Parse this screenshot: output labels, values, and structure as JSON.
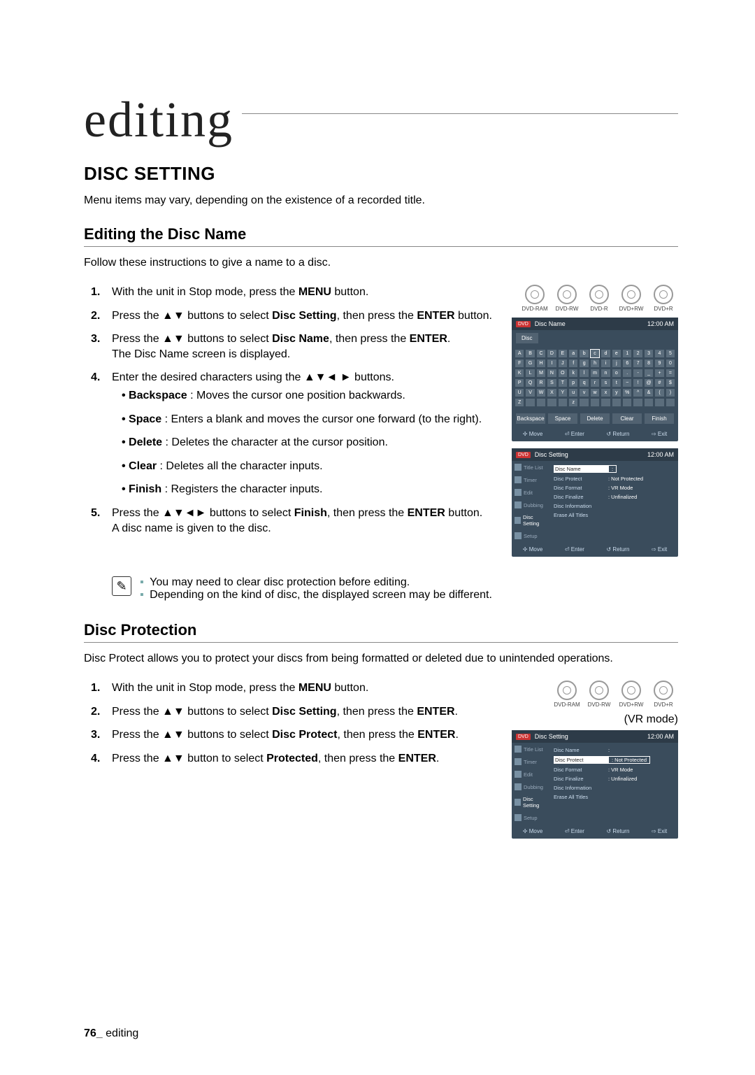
{
  "chapter": "editing",
  "section": "DISC SETTING",
  "intro": "Menu items may vary, depending on the existence of a recorded title.",
  "sub1": {
    "title": "Editing the Disc Name",
    "desc": "Follow these instructions to give a name to a disc.",
    "steps": [
      {
        "n": "1.",
        "pre": "With the unit in Stop mode, press the ",
        "bold": "MENU",
        "post": " button."
      },
      {
        "n": "2.",
        "pre": "Press the ▲▼ buttons to select ",
        "bold": "Disc Setting",
        "post": ", then press the ",
        "bold2": "ENTER",
        "post2": " button."
      },
      {
        "n": "3.",
        "pre": "Press the ▲▼ buttons to select ",
        "bold": "Disc Name",
        "post": ", then press the ",
        "bold2": "ENTER",
        "post2": ".",
        "after": "The Disc Name screen is displayed."
      },
      {
        "n": "4.",
        "pre": "Enter the desired characters using the ▲▼◄ ► buttons.",
        "bullets": [
          {
            "b": "Backspace",
            "t": " : Moves the cursor one position backwards."
          },
          {
            "b": "Space",
            "t": " : Enters a blank and moves the cursor one forward (to the right)."
          },
          {
            "b": "Delete",
            "t": " : Deletes the character at the cursor position."
          },
          {
            "b": "Clear",
            "t": " : Deletes all the character inputs."
          },
          {
            "b": "Finish",
            "t": " : Registers the character inputs."
          }
        ]
      },
      {
        "n": "5.",
        "pre": "Press the ▲▼◄► buttons to select ",
        "bold": "Finish",
        "post": ", then press the ",
        "bold2": "ENTER",
        "post2": " button.",
        "after": "A disc name is given to the disc."
      }
    ],
    "notes": [
      "You may need to clear disc protection before editing.",
      "Depending on the kind of disc, the displayed screen may be different."
    ],
    "disctypes": [
      "DVD-RAM",
      "DVD-RW",
      "DVD-R",
      "DVD+RW",
      "DVD+R"
    ]
  },
  "osd1": {
    "title": "Disc Name",
    "time": "12:00 AM",
    "tab": "Disc",
    "rows": [
      [
        "A",
        "B",
        "C",
        "D",
        "E",
        "a",
        "b",
        "c",
        "d",
        "e",
        "1",
        "2",
        "3",
        "4",
        "5"
      ],
      [
        "F",
        "G",
        "H",
        "I",
        "J",
        "f",
        "g",
        "h",
        "i",
        "j",
        "6",
        "7",
        "8",
        "9",
        "0"
      ],
      [
        "K",
        "L",
        "M",
        "N",
        "O",
        "k",
        "l",
        "m",
        "n",
        "o",
        ".",
        "-",
        "_",
        "+",
        "="
      ],
      [
        "P",
        "Q",
        "R",
        "S",
        "T",
        "p",
        "q",
        "r",
        "s",
        "t",
        "~",
        "!",
        "@",
        "#",
        "$"
      ],
      [
        "U",
        "V",
        "W",
        "X",
        "Y",
        "u",
        "v",
        "w",
        "x",
        "y",
        "%",
        "^",
        "&",
        "(",
        ")"
      ],
      [
        "Z",
        "",
        "",
        "",
        "",
        "z",
        "",
        "",
        "",
        "",
        "",
        "",
        "",
        "",
        ""
      ]
    ],
    "buttons": [
      "Backspace",
      "Space",
      "Delete",
      "Clear",
      "Finish"
    ],
    "nav": [
      "✢ Move",
      "⏎ Enter",
      "↺ Return",
      "⇨ Exit"
    ]
  },
  "osd2": {
    "title": "Disc Setting",
    "time": "12:00 AM",
    "side": [
      "Title List",
      "Timer",
      "Edit",
      "Dubbing",
      "Disc Setting",
      "Setup"
    ],
    "rows": [
      {
        "k": "Disc Name",
        "v": ":",
        "hl": true
      },
      {
        "k": "Disc Protect",
        "v": ": Not Protected"
      },
      {
        "k": "Disc Format",
        "v": ": VR Mode"
      },
      {
        "k": "Disc Finalize",
        "v": ": Unfinalized"
      },
      {
        "k": "Disc Information",
        "v": ""
      },
      {
        "k": "Erase All Titles",
        "v": ""
      }
    ],
    "nav": [
      "✢ Move",
      "⏎ Enter",
      "↺ Return",
      "⇨ Exit"
    ]
  },
  "sub2": {
    "title": "Disc Protection",
    "desc": "Disc Protect allows you to protect your discs from being formatted or deleted due to unintended operations.",
    "disctypes": [
      "DVD-RAM",
      "DVD-RW",
      "DVD+RW",
      "DVD+R"
    ],
    "vrmode": "(VR mode)",
    "steps": [
      {
        "n": "1.",
        "pre": "With the unit in Stop mode, press the ",
        "bold": "MENU",
        "post": " button."
      },
      {
        "n": "2.",
        "pre": "Press the ▲▼ buttons to select ",
        "bold": "Disc Setting",
        "post": ", then press the ",
        "bold2": "ENTER",
        "post2": "."
      },
      {
        "n": "3.",
        "pre": "Press the ▲▼ buttons to select ",
        "bold": "Disc Protect",
        "post": ", then press the ",
        "bold2": "ENTER",
        "post2": "."
      },
      {
        "n": "4.",
        "pre": "Press the ▲▼ button to select ",
        "bold": "Protected",
        "post": ", then press the ",
        "bold2": "ENTER",
        "post2": "."
      }
    ]
  },
  "osd3": {
    "title": "Disc Setting",
    "time": "12:00 AM",
    "side": [
      "Title List",
      "Timer",
      "Edit",
      "Dubbing",
      "Disc Setting",
      "Setup"
    ],
    "rows": [
      {
        "k": "Disc Name",
        "v": ":"
      },
      {
        "k": "Disc Protect",
        "v": ": Not Protected",
        "hl": true
      },
      {
        "k": "Disc Format",
        "v": ": VR Mode"
      },
      {
        "k": "Disc Finalize",
        "v": ": Unfinalized"
      },
      {
        "k": "Disc Information",
        "v": ""
      },
      {
        "k": "Erase All Titles",
        "v": ""
      }
    ],
    "nav": [
      "✢ Move",
      "⏎ Enter",
      "↺ Return",
      "⇨ Exit"
    ]
  },
  "footer": {
    "page": "76_",
    "label": " editing"
  }
}
